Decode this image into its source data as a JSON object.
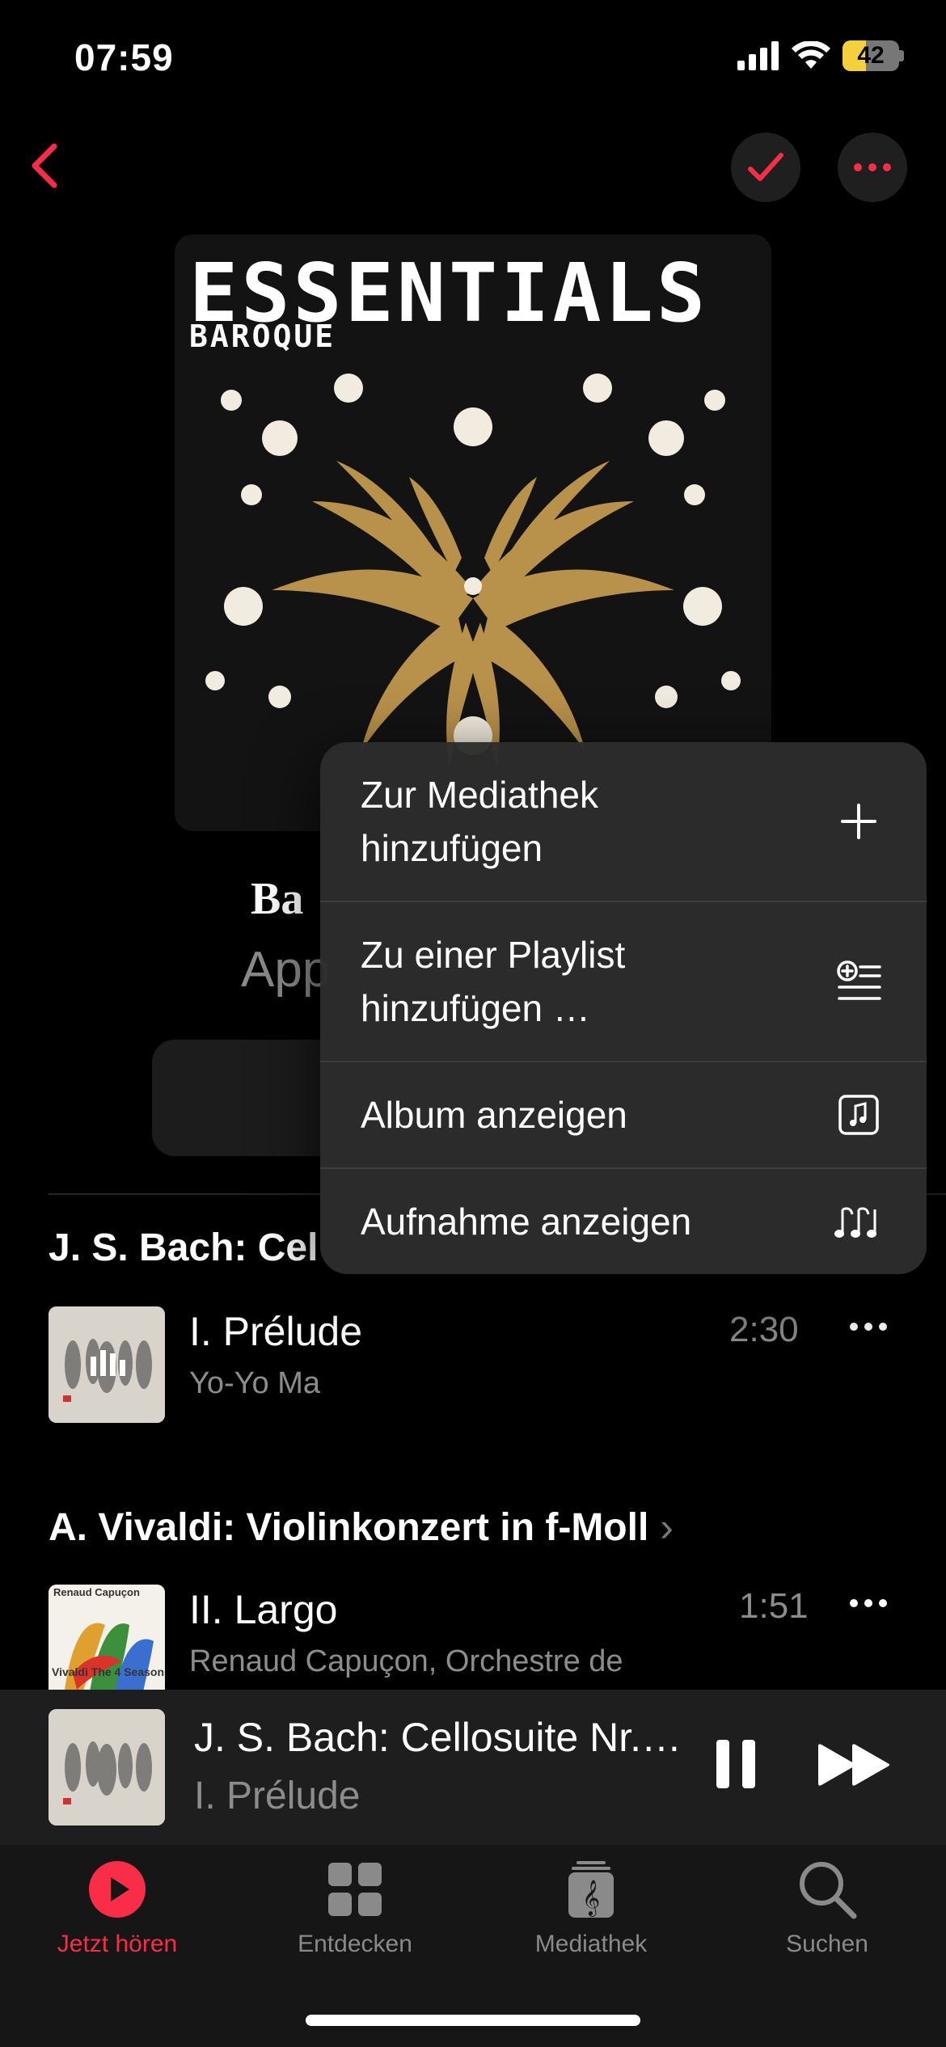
{
  "status_bar": {
    "time": "07:59",
    "battery": "42"
  },
  "artwork": {
    "title": "ESSENTIALS",
    "subtitle": "BAROQUE"
  },
  "album": {
    "title_partial": "Ba",
    "subtitle_partial": "App"
  },
  "sections": [
    {
      "title": "J. S. Bach: Cel",
      "track": {
        "title": "I. Prélude",
        "artist": "Yo-Yo Ma",
        "duration": "2:30"
      }
    },
    {
      "title": "A. Vivaldi: Violinkonzert in f-Moll",
      "track": {
        "title": "II. Largo",
        "artist": "Renaud Capuçon, Orchestre de",
        "duration": "1:51"
      },
      "art_text": {
        "top": "Renaud Capuçon",
        "bottom": "Vivaldi The 4 Seasons"
      }
    }
  ],
  "context_menu": {
    "items": [
      {
        "label": "Zur Mediathek\nhinzufügen",
        "icon": "plus-icon"
      },
      {
        "label": "Zu einer Playlist\nhinzufügen …",
        "icon": "add-to-playlist-icon"
      },
      {
        "label": "Album anzeigen",
        "icon": "album-icon"
      },
      {
        "label": "Aufnahme anzeigen",
        "icon": "music-notes-icon"
      }
    ]
  },
  "mini_player": {
    "title": "J. S. Bach: Cellosuite Nr.…",
    "subtitle": "I. Prélude"
  },
  "tabs": [
    {
      "label": "Jetzt hören",
      "icon": "play-circle-icon",
      "active": true
    },
    {
      "label": "Entdecken",
      "icon": "grid-icon",
      "active": false
    },
    {
      "label": "Mediathek",
      "icon": "library-icon",
      "active": false
    },
    {
      "label": "Suchen",
      "icon": "search-icon",
      "active": false
    }
  ],
  "colors": {
    "accent": "#fa2d48",
    "gold": "#b8914a",
    "background": "#000000"
  }
}
